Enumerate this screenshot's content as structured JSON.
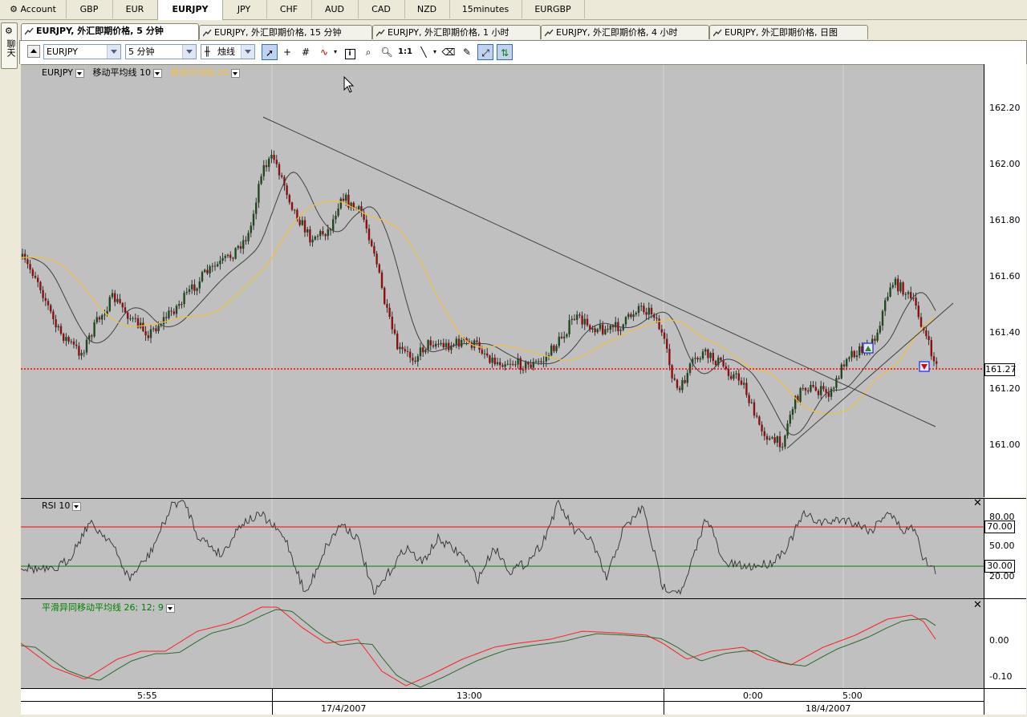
{
  "top_tabs": [
    {
      "label": "Account",
      "icon": "account-icon"
    },
    {
      "label": "GBP"
    },
    {
      "label": "EUR"
    },
    {
      "label": "EURJPY",
      "active": true
    },
    {
      "label": "JPY"
    },
    {
      "label": "CHF"
    },
    {
      "label": "AUD"
    },
    {
      "label": "CAD"
    },
    {
      "label": "NZD"
    },
    {
      "label": "15minutes"
    },
    {
      "label": "EURGBP"
    }
  ],
  "side_tab": {
    "label": "聊天"
  },
  "chart_tabs": [
    {
      "label": "EURJPY, 外汇即期价格, 5 分钟",
      "active": true
    },
    {
      "label": "EURJPY, 外汇即期价格, 15 分钟"
    },
    {
      "label": "EURJPY, 外汇即期价格, 1 小时"
    },
    {
      "label": "EURJPY, 外汇即期价格, 4 小时"
    },
    {
      "label": "EURJPY, 外汇即期价格, 日图"
    }
  ],
  "toolbar": {
    "symbol": "EURJPY",
    "timeframe": "5 分钟",
    "chart_style": "烛线",
    "ratio_label": "1:1"
  },
  "legend": {
    "symbol": "EURJPY",
    "ma10": "移动平均线 10",
    "ma20": "移动平均线 20",
    "ma10_color": "#404040",
    "ma20_color": "#f0c040"
  },
  "price_axis": {
    "ticks": [
      "162.20",
      "162.00",
      "161.80",
      "161.60",
      "161.40",
      "161.20",
      "161.00"
    ],
    "current": "161.27"
  },
  "rsi": {
    "label": "RSI 10",
    "ticks": [
      "80.00",
      "50.00",
      "20.00"
    ],
    "upper": "70.00",
    "lower": "30.00",
    "upper_color": "#ff0000",
    "lower_color": "#008000"
  },
  "macd": {
    "label": "平滑异同移动平均线 26; 12; 9",
    "ticks": [
      "0.00",
      "-0.10"
    ],
    "label_color": "#008000"
  },
  "time_axis": {
    "times": [
      "5:55",
      "13:00",
      "0:00",
      "5:00"
    ],
    "dates": [
      "17/4/2007",
      "18/4/2007"
    ]
  },
  "colors": {
    "pane_bg": "#c0c0c0",
    "bull": "#1f4a1f",
    "bear": "#8b1010",
    "current_line": "#ff0000"
  }
}
